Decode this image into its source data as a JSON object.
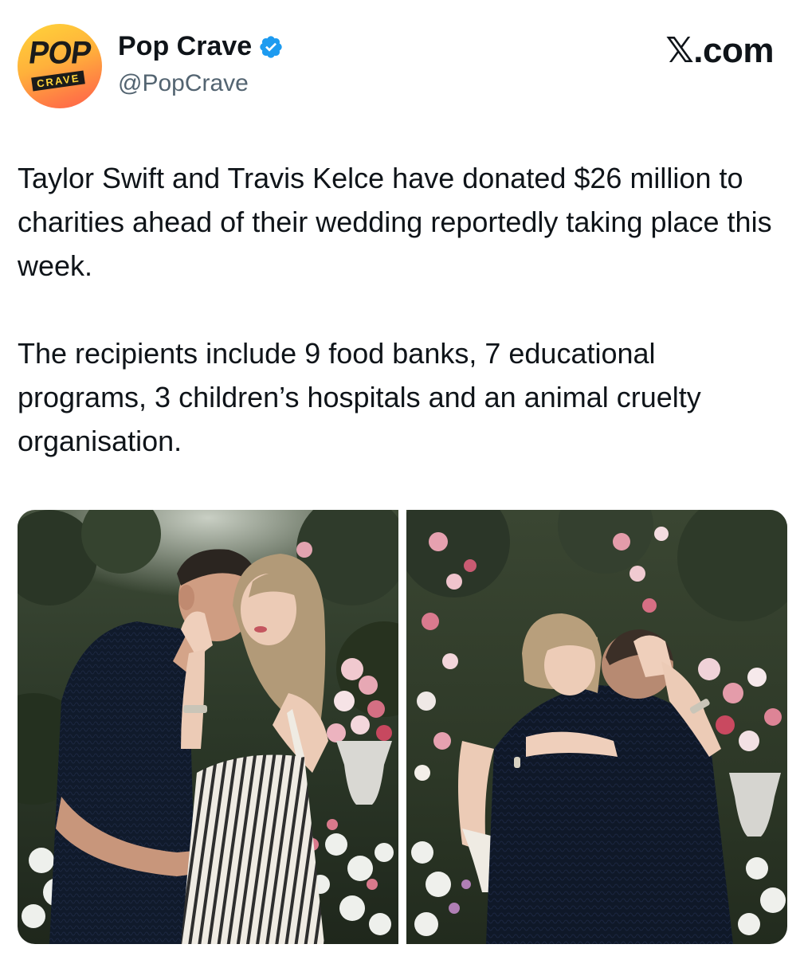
{
  "author": {
    "display_name": "Pop Crave",
    "handle": "@PopCrave",
    "avatar_text_top": "POP",
    "avatar_text_bottom": "CRAVE",
    "verified": true
  },
  "brand": "𝕏.com",
  "tweet": {
    "paragraphs": [
      "Taylor Swift and Travis Kelce have donated $26 million to charities ahead of their wedding reportedly taking place this week.",
      "The recipients include 9 food banks, 7 educational programs, 3 children’s hospitals and an animal cruelty organisation."
    ]
  },
  "media": {
    "count": 2
  },
  "colors": {
    "text": "#0f1419",
    "secondary_text": "#536471",
    "verified_blue": "#1d9bf0"
  }
}
